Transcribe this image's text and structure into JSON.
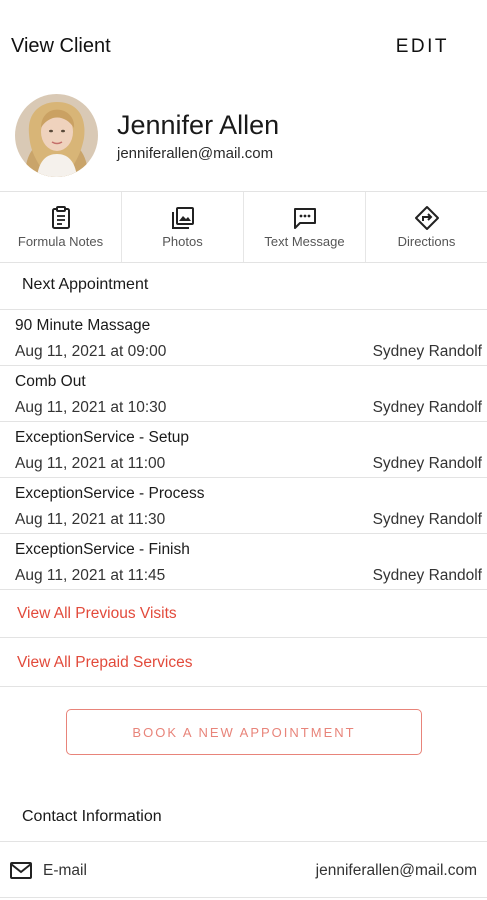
{
  "header": {
    "title": "View Client",
    "edit_label": "EDIT"
  },
  "client": {
    "name": "Jennifer Allen",
    "email": "jenniferallen@mail.com"
  },
  "actions": [
    {
      "label": "Formula Notes",
      "icon": "clipboard-icon"
    },
    {
      "label": "Photos",
      "icon": "photos-icon"
    },
    {
      "label": "Text Message",
      "icon": "message-icon"
    },
    {
      "label": "Directions",
      "icon": "directions-icon"
    }
  ],
  "next_appointment": {
    "title": "Next Appointment",
    "items": [
      {
        "service": "90 Minute Massage",
        "when": "Aug 11, 2021 at 09:00",
        "staff": "Sydney Randolf"
      },
      {
        "service": "Comb Out",
        "when": "Aug 11, 2021 at 10:30",
        "staff": "Sydney Randolf"
      },
      {
        "service": "ExceptionService - Setup",
        "when": "Aug 11, 2021 at 11:00",
        "staff": "Sydney Randolf"
      },
      {
        "service": "ExceptionService - Process",
        "when": "Aug 11, 2021 at 11:30",
        "staff": "Sydney Randolf"
      },
      {
        "service": "ExceptionService - Finish",
        "when": "Aug 11, 2021 at 11:45",
        "staff": "Sydney Randolf"
      }
    ]
  },
  "links": {
    "previous_visits": "View All Previous Visits",
    "prepaid_services": "View All Prepaid Services"
  },
  "book_button": "BOOK A NEW APPOINTMENT",
  "contact": {
    "title": "Contact Information",
    "rows": [
      {
        "type": "E-mail",
        "value": "jenniferallen@mail.com",
        "icon": "mail-icon"
      }
    ]
  },
  "colors": {
    "accent": "#e24a3b",
    "button_border": "#e8847a",
    "divider": "#e3e3e3"
  }
}
